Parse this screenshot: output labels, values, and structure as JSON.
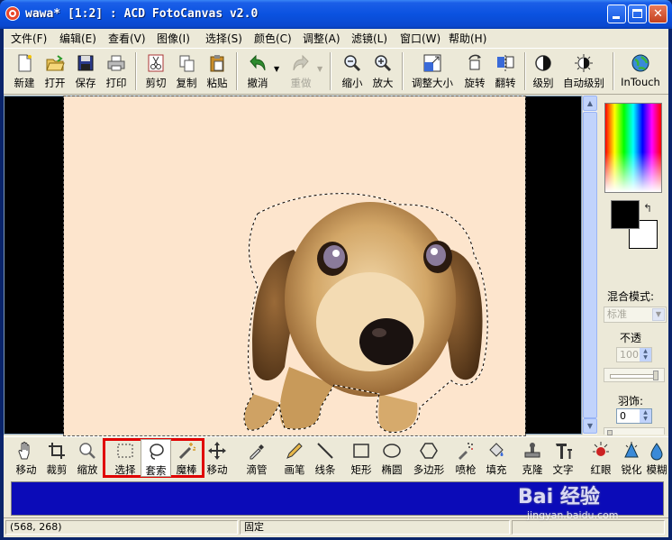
{
  "window": {
    "title": "wawa* [1:2] : ACD FotoCanvas v2.0"
  },
  "menu": [
    {
      "label": "文件(F)"
    },
    {
      "label": "编辑(E)"
    },
    {
      "label": "查看(V)"
    },
    {
      "label": "图像(I)"
    },
    {
      "label": "选择(S)"
    },
    {
      "label": "颜色(C)"
    },
    {
      "label": "调整(A)"
    },
    {
      "label": "滤镜(L)"
    },
    {
      "label": "窗口(W)"
    },
    {
      "label": "帮助(H)"
    }
  ],
  "toolbar": [
    {
      "label": "新建",
      "icon": "new-file-icon"
    },
    {
      "label": "打开",
      "icon": "open-folder-icon"
    },
    {
      "label": "保存",
      "icon": "save-disk-icon"
    },
    {
      "label": "打印",
      "icon": "printer-icon"
    },
    {
      "label": "剪切",
      "icon": "scissors-icon"
    },
    {
      "label": "复制",
      "icon": "copy-icon"
    },
    {
      "label": "粘贴",
      "icon": "paste-icon"
    },
    {
      "label": "撤消",
      "icon": "undo-arrow-icon"
    },
    {
      "label": "重做",
      "icon": "redo-arrow-icon",
      "disabled": true
    },
    {
      "label": "缩小",
      "icon": "zoom-out-icon"
    },
    {
      "label": "放大",
      "icon": "zoom-in-icon"
    },
    {
      "label": "调整大小",
      "icon": "resize-icon"
    },
    {
      "label": "旋转",
      "icon": "rotate-icon"
    },
    {
      "label": "翻转",
      "icon": "flip-icon"
    },
    {
      "label": "级别",
      "icon": "levels-icon"
    },
    {
      "label": "自动级别",
      "icon": "auto-levels-icon"
    },
    {
      "label": "InTouch",
      "icon": "globe-icon"
    }
  ],
  "right_panel": {
    "blend_mode_label": "混合模式:",
    "blend_mode_value": "标准",
    "opacity_label": "不透",
    "opacity_value": "100",
    "feather_label": "羽饰:",
    "feather_value": "0"
  },
  "tools": [
    {
      "label": "移动",
      "icon": "hand-icon"
    },
    {
      "label": "裁剪",
      "icon": "crop-icon"
    },
    {
      "label": "缩放",
      "icon": "magnifier-icon"
    },
    {
      "label": "选择",
      "icon": "rect-select-icon"
    },
    {
      "label": "套索",
      "icon": "lasso-icon"
    },
    {
      "label": "魔棒",
      "icon": "magic-wand-icon"
    },
    {
      "label": "移动",
      "icon": "move-arrows-icon"
    },
    {
      "label": "滴管",
      "icon": "eyedropper-icon"
    },
    {
      "label": "画笔",
      "icon": "pencil-icon"
    },
    {
      "label": "线条",
      "icon": "line-icon"
    },
    {
      "label": "矩形",
      "icon": "rectangle-icon"
    },
    {
      "label": "椭圆",
      "icon": "ellipse-icon"
    },
    {
      "label": "多边形",
      "icon": "polygon-icon"
    },
    {
      "label": "喷枪",
      "icon": "airbrush-icon"
    },
    {
      "label": "填充",
      "icon": "bucket-icon"
    },
    {
      "label": "克隆",
      "icon": "clone-stamp-icon"
    },
    {
      "label": "文字",
      "icon": "text-icon"
    },
    {
      "label": "红眼",
      "icon": "red-eye-icon"
    },
    {
      "label": "锐化",
      "icon": "sharpen-icon"
    },
    {
      "label": "模糊",
      "icon": "blur-icon"
    }
  ],
  "status": {
    "coords": "(568, 268)",
    "mode": "固定"
  },
  "watermark": {
    "main": "Bai 经验",
    "sub": "jingyan.baidu.com"
  }
}
